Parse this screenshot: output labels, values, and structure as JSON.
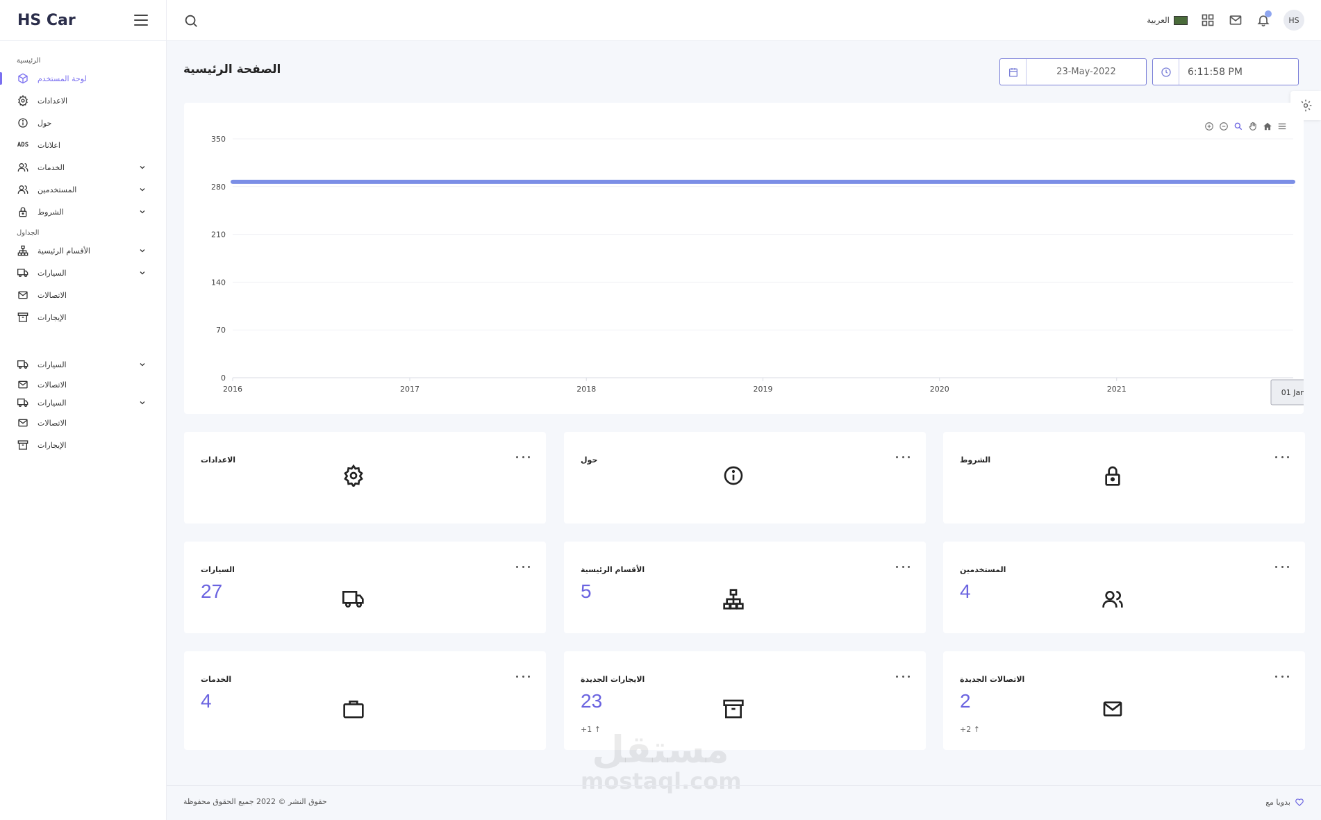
{
  "brand": {
    "title": "HS Car"
  },
  "sidebar": {
    "items": [
      {
        "type": "section",
        "label": "الرئيسية"
      },
      {
        "type": "item",
        "label": "لوحة المستخدم",
        "icon": "cube-icon",
        "active": true
      },
      {
        "type": "item",
        "label": "الاعدادات",
        "icon": "gear-icon"
      },
      {
        "type": "item",
        "label": "حول",
        "icon": "info-icon"
      },
      {
        "type": "item",
        "label": "اعلانات",
        "icon": "ads-icon"
      },
      {
        "type": "item",
        "label": "الخدمات",
        "icon": "users-icon",
        "chevron": true
      },
      {
        "type": "item",
        "label": "المستخدمين",
        "icon": "users-icon",
        "chevron": true
      },
      {
        "type": "item",
        "label": "الشروط",
        "icon": "lock-icon",
        "chevron": true
      },
      {
        "type": "section",
        "label": "الجداول"
      },
      {
        "type": "item",
        "label": "الأقسام الرئيسية",
        "icon": "sitemap-icon",
        "chevron": true
      },
      {
        "type": "item",
        "label": "السيارات",
        "icon": "truck-icon",
        "chevron": true
      },
      {
        "type": "item",
        "label": "الاتصالات",
        "icon": "mail-icon"
      },
      {
        "type": "item",
        "label": "الإيجارات",
        "icon": "archive-icon"
      },
      {
        "type": "spacer"
      },
      {
        "type": "item",
        "label": "السيارات",
        "icon": "truck-icon",
        "chevron": true
      },
      {
        "type": "item",
        "label": "الاتصالات",
        "icon": "mail-icon",
        "tight": true
      },
      {
        "type": "item",
        "label": "السيارات",
        "icon": "truck-icon",
        "chevron": true,
        "tight": true
      },
      {
        "type": "item",
        "label": "الاتصالات",
        "icon": "mail-icon"
      },
      {
        "type": "item",
        "label": "الإيجارات",
        "icon": "archive-icon"
      }
    ]
  },
  "topbar": {
    "language": "العربية",
    "avatar_initials": "HS"
  },
  "page": {
    "title": "الصفحة الرئيسية",
    "date": "23-May-2022",
    "time": "6:11:58 PM"
  },
  "chart_data": {
    "type": "line",
    "x": [
      "2016-01-01",
      "2022-01-01"
    ],
    "x_ticks": [
      "2016",
      "2017",
      "2018",
      "2019",
      "2020",
      "2021"
    ],
    "y_ticks": [
      "0",
      "70",
      "140",
      "210",
      "280",
      "350"
    ],
    "ylim": [
      0,
      350
    ],
    "series": [
      {
        "values": [
          287,
          287
        ]
      }
    ],
    "tooltip": "01 Jan",
    "colors": {
      "line": "#7b8ee6"
    }
  },
  "cards": [
    {
      "title": "الاعدادات",
      "icon": "gear-icon"
    },
    {
      "title": "حول",
      "icon": "info-icon"
    },
    {
      "title": "الشروط",
      "icon": "lock-icon"
    },
    {
      "title": "السيارات",
      "icon": "truck-icon",
      "value": "27"
    },
    {
      "title": "الأقسام الرئيسية",
      "icon": "sitemap-icon",
      "value": "5"
    },
    {
      "title": "المستخدمين",
      "icon": "users-icon",
      "value": "4"
    },
    {
      "title": "الخدمات",
      "icon": "briefcase-icon",
      "value": "4"
    },
    {
      "title": "الايجارات الجديدة",
      "icon": "archive-icon",
      "value": "23",
      "delta": "+1"
    },
    {
      "title": "الاتصالات الجديدة",
      "icon": "mail-icon",
      "value": "2",
      "delta": "+2"
    }
  ],
  "footer": {
    "copyright": "حقوق النشر © 2022 جميع الحقوق محفوظة",
    "made_with": "بدويا مع"
  },
  "watermark": {
    "arabic": "مستقل",
    "latin": "mostaql.com"
  },
  "colors": {
    "accent": "#7a6ff0",
    "value": "#6a63e0"
  }
}
